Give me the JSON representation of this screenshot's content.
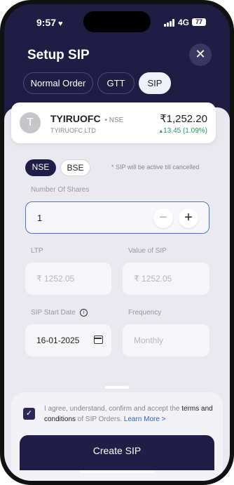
{
  "status": {
    "time": "9:57",
    "network": "4G",
    "battery": "77"
  },
  "header": {
    "title": "Setup SIP",
    "close_icon": "close-icon"
  },
  "tabs": [
    {
      "label": "Normal Order",
      "active": false
    },
    {
      "label": "GTT",
      "active": false
    },
    {
      "label": "SIP",
      "active": true
    }
  ],
  "stock": {
    "logo_letter": "T",
    "symbol": "TYIRUOFC",
    "exchange_tag": "• NSE",
    "full_name": "TYIRUOFC LTD",
    "price": "₹1,252.20",
    "change": "13.45 (1.09%)",
    "change_color": "#1e9a5a"
  },
  "exchange": {
    "options": [
      "NSE",
      "BSE"
    ],
    "selected": "NSE",
    "note": "* SIP will be active till cancelled"
  },
  "shares": {
    "label": "Number Of Shares",
    "value": "1",
    "minus": "−",
    "plus": "+"
  },
  "ltp": {
    "label": "LTP",
    "value": "₹ 1252.05"
  },
  "sip_value": {
    "label": "Value of SIP",
    "value": "₹ 1252.05"
  },
  "start_date": {
    "label": "SIP Start Date",
    "info_icon": "i",
    "value": "16-01-2025"
  },
  "frequency": {
    "label": "Frequency",
    "placeholder": "Monthly"
  },
  "consent": {
    "checked": true,
    "text1": "I agree, understand, confirm and accept the ",
    "terms": "terms and conditions",
    "text2": " of SIP Orders. ",
    "learn_more": "Learn More >"
  },
  "cta": {
    "label": "Create SIP"
  },
  "colors": {
    "brand": "#201e47",
    "accent_link": "#2f5fc8",
    "header_bg": "#1f1d44"
  }
}
